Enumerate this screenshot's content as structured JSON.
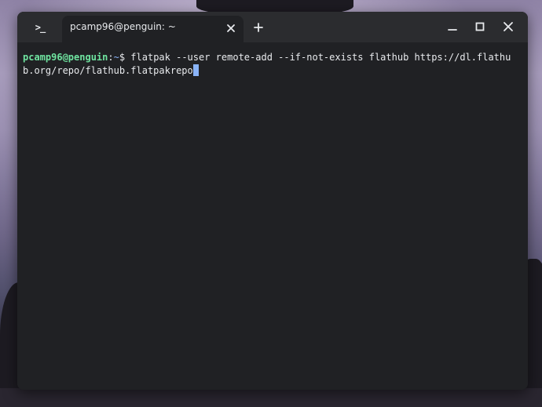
{
  "window": {
    "app_icon": "terminal-prompt-icon",
    "tab": {
      "title": "pcamp96@penguin: ~",
      "close_icon": "close-icon"
    },
    "new_tab_icon": "plus-icon",
    "controls": {
      "minimize_icon": "minimize-icon",
      "maximize_icon": "maximize-icon",
      "close_icon": "close-icon"
    }
  },
  "terminal": {
    "prompt_user_host": "pcamp96@penguin",
    "prompt_separator": ":",
    "prompt_path": "~",
    "prompt_symbol": "$ ",
    "command": "flatpak --user remote-add --if-not-exists flathub https://dl.flathub.org/repo/flathub.flatpakrepo"
  },
  "colors": {
    "terminal_bg": "#202124",
    "titlebar_bg": "#2b2c2f",
    "prompt_user": "#6fe4a0",
    "cursor": "#8ab4f8",
    "text": "#e8eaed"
  }
}
